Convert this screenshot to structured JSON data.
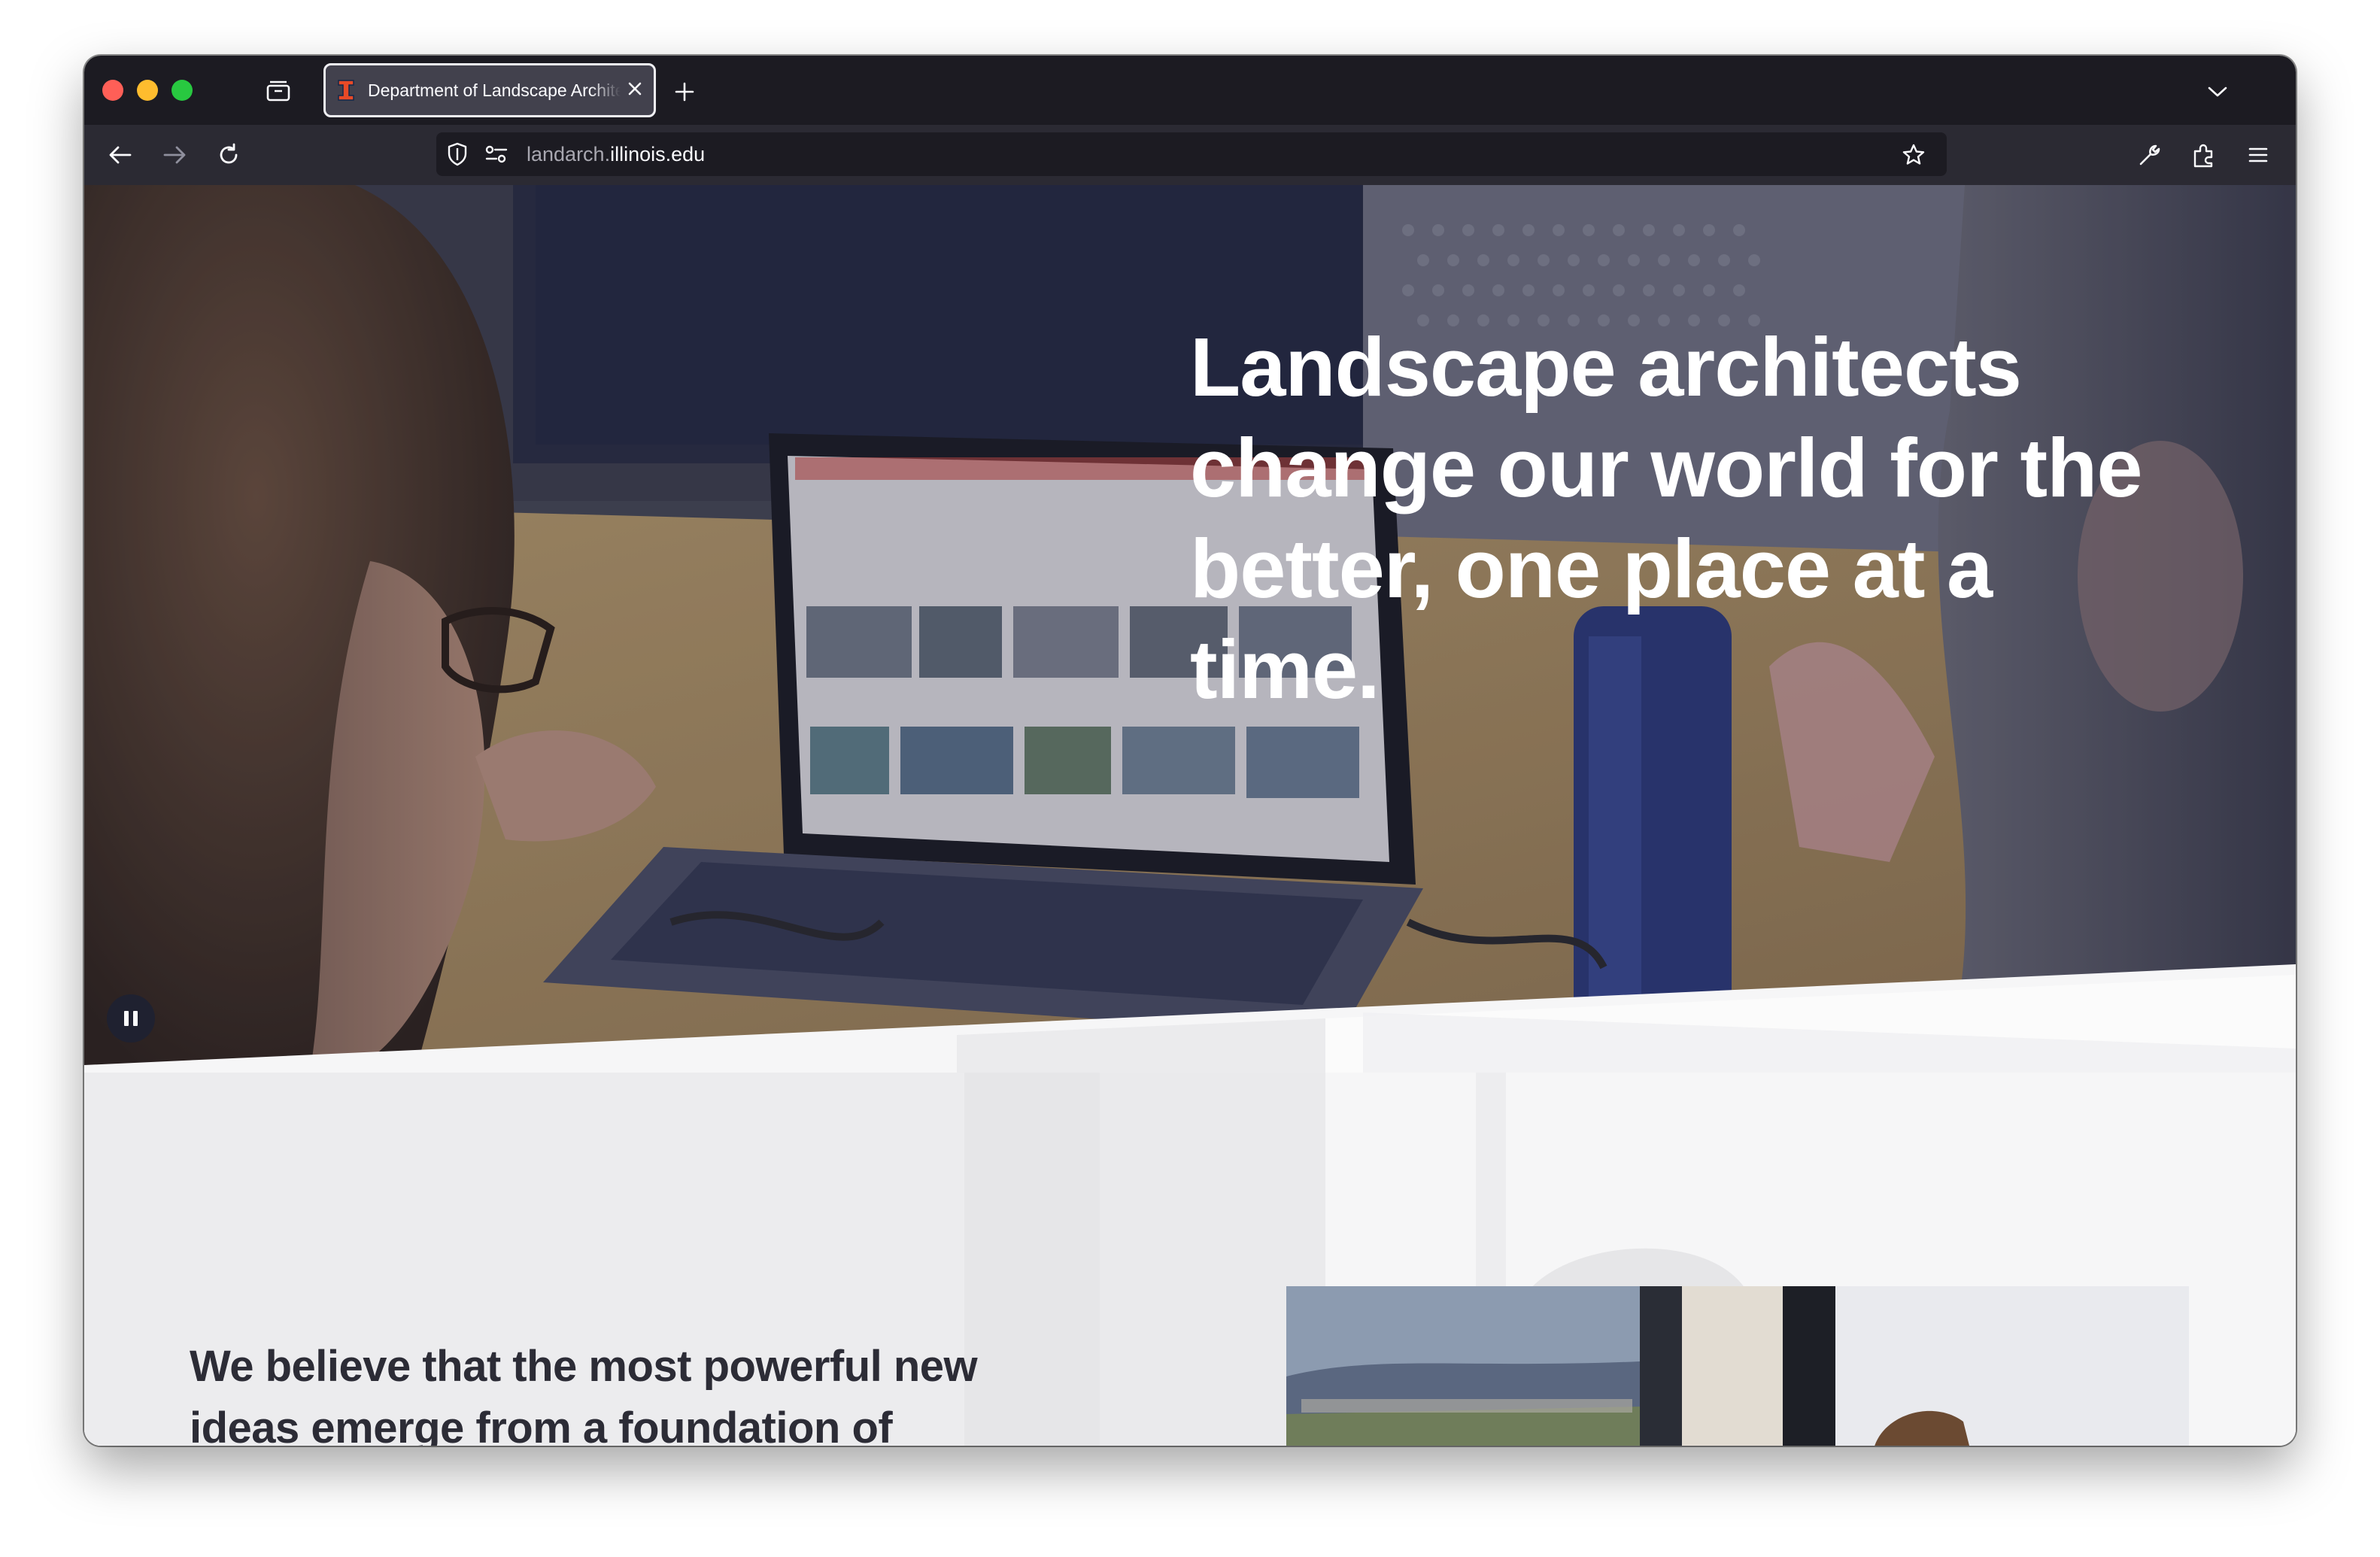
{
  "browser": {
    "tab": {
      "title": "Department of Landscape Architecture"
    },
    "url": {
      "prefix": "landarch.",
      "domain": "illinois.edu"
    },
    "icons": {
      "sidebar": "sidebar-icon",
      "new_tab": "plus-icon",
      "tab_list": "chevron-down-icon",
      "back": "back-arrow-icon",
      "forward": "forward-arrow-icon",
      "reload": "reload-icon",
      "shield": "shield-icon",
      "permissions": "permissions-icon",
      "bookmark": "star-icon",
      "devtools": "wrench-icon",
      "extensions": "puzzle-icon",
      "menu": "hamburger-icon"
    }
  },
  "hero": {
    "headline": "Landscape architects change our world for the better, one place at a time.",
    "pause_icon": "pause-icon"
  },
  "intro": {
    "text": "We believe that the most powerful new ideas emerge from a foundation of"
  },
  "colors": {
    "tab_strip": "#1c1b22",
    "nav_bar": "#2b2a33",
    "url_field": "#1c1b22",
    "illinois_orange": "#e84a27",
    "heading_text": "#2c2c36"
  }
}
